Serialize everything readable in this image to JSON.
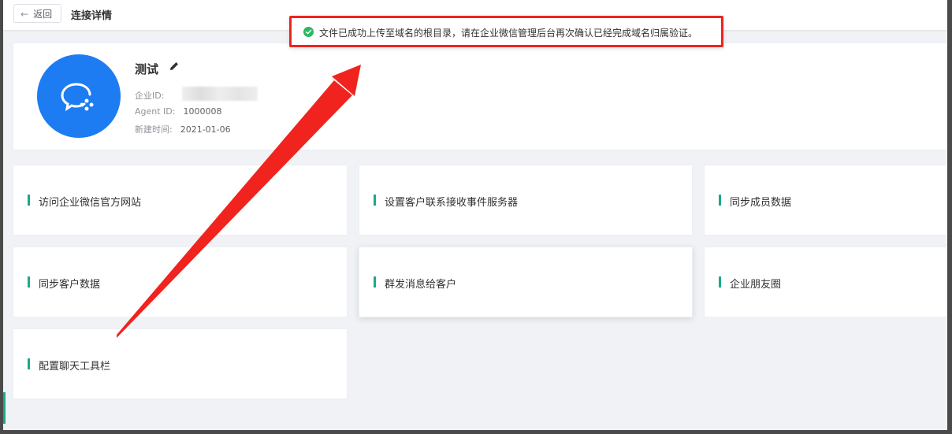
{
  "header": {
    "back_label": "返回",
    "title": "连接详情"
  },
  "toast": {
    "message": "文件已成功上传至域名的根目录，请在企业微信管理后台再次确认已经完成域名归属验证。"
  },
  "profile": {
    "name": "测试",
    "corp_id_label": "企业ID:",
    "agent_id_label": "Agent ID:",
    "agent_id": "1000008",
    "created_label": "新建时间:",
    "created": "2021-01-06"
  },
  "features": [
    {
      "label": "访问企业微信官方网站"
    },
    {
      "label": "设置客户联系接收事件服务器"
    },
    {
      "label": "同步成员数据"
    },
    {
      "label": "同步客户数据"
    },
    {
      "label": "群发消息给客户"
    },
    {
      "label": "企业朋友圈"
    },
    {
      "label": "配置聊天工具栏"
    }
  ],
  "colors": {
    "accent": "#1aaa8a",
    "avatar": "#1e7cf2",
    "highlight": "#f0231e",
    "success": "#2ab860"
  }
}
